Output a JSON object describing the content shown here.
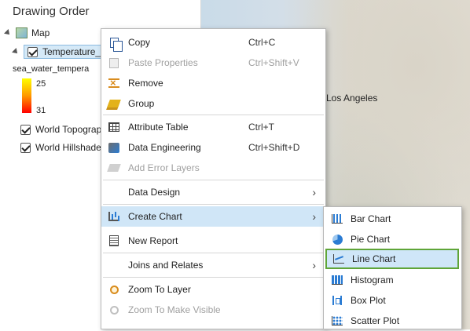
{
  "contents_pane": {
    "title": "Drawing Order",
    "map_label": "Map",
    "selected_layer": "Temperature_Jun",
    "field_name": "sea_water_tempera",
    "legend_max": "25",
    "legend_min": "31",
    "layers": [
      "World Topograp",
      "World Hillshade"
    ]
  },
  "map": {
    "city_label": "Los Angeles"
  },
  "context_menu": {
    "items": [
      {
        "label": "Copy",
        "shortcut": "Ctrl+C",
        "icon": "copy-icon",
        "enabled": true
      },
      {
        "label": "Paste Properties",
        "shortcut": "Ctrl+Shift+V",
        "icon": "paste-icon",
        "enabled": false
      },
      {
        "label": "Remove",
        "shortcut": "",
        "icon": "remove-icon",
        "enabled": true
      },
      {
        "label": "Group",
        "shortcut": "",
        "icon": "group-icon",
        "enabled": true
      },
      {
        "label": "Attribute Table",
        "shortcut": "Ctrl+T",
        "icon": "table-icon",
        "enabled": true
      },
      {
        "label": "Data Engineering",
        "shortcut": "Ctrl+Shift+D",
        "icon": "data-engineering-icon",
        "enabled": true
      },
      {
        "label": "Add Error Layers",
        "shortcut": "",
        "icon": "error-layers-icon",
        "enabled": false
      },
      {
        "label": "Data Design",
        "shortcut": "",
        "icon": "",
        "enabled": true
      },
      {
        "label": "Create Chart",
        "shortcut": "",
        "icon": "chart-icon",
        "enabled": true
      },
      {
        "label": "New Report",
        "shortcut": "",
        "icon": "report-icon",
        "enabled": true
      },
      {
        "label": "Joins and Relates",
        "shortcut": "",
        "icon": "",
        "enabled": true
      },
      {
        "label": "Zoom To Layer",
        "shortcut": "",
        "icon": "zoom-icon",
        "enabled": true
      },
      {
        "label": "Zoom To Make Visible",
        "shortcut": "",
        "icon": "zoom-visible-icon",
        "enabled": false
      }
    ]
  },
  "chart_submenu": {
    "items": [
      {
        "label": "Bar Chart",
        "icon": "bar-chart-icon"
      },
      {
        "label": "Pie Chart",
        "icon": "pie-chart-icon"
      },
      {
        "label": "Line Chart",
        "icon": "line-chart-icon",
        "selected": true
      },
      {
        "label": "Histogram",
        "icon": "histogram-icon"
      },
      {
        "label": "Box Plot",
        "icon": "box-plot-icon"
      },
      {
        "label": "Scatter Plot",
        "icon": "scatter-plot-icon"
      }
    ]
  },
  "colors": {
    "highlight": "#d0e6f7",
    "selected_outline": "#5fa538",
    "legend_ramp": [
      "#ffff00",
      "#ff9900",
      "#ff0000"
    ]
  }
}
